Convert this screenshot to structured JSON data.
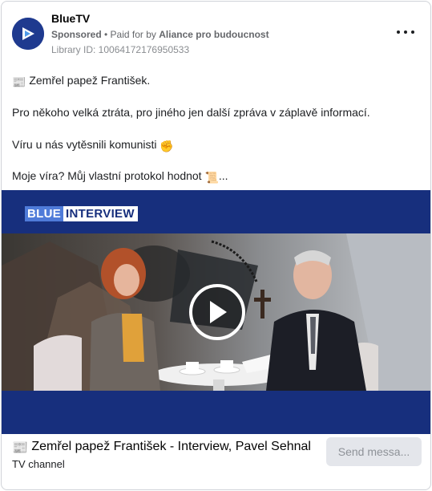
{
  "header": {
    "page_name": "BlueTV",
    "sponsored": "Sponsored",
    "separator": " • ",
    "paid_prefix": "Paid for by ",
    "payer": "Aliance pro budoucnost",
    "library_id": "Library ID: 10064172176950533"
  },
  "post": {
    "line1_emoji": "📰",
    "line1": "Zemřel papež František.",
    "line2": "Pro někoho velká ztráta, pro jiného jen další zpráva v záplavě informací.",
    "line3": "Víru u nás vytěsnili komunisti",
    "line3_emoji": "✊",
    "line4": "Moje víra? Můj vlastní protokol hodnot",
    "line4_emoji": "📜",
    "line4_suffix": "..."
  },
  "video": {
    "logo_part1": "BLUE",
    "logo_part2": "INTERVIEW",
    "play_icon": "play-icon"
  },
  "footer": {
    "title_emoji": "📰",
    "title": "Zemřel papež František - Interview, Pavel Sehnal",
    "subtitle": "TV channel",
    "cta": "Send messa..."
  },
  "colors": {
    "brand_blue": "#172f7d",
    "avatar_bg": "#1f3a8f",
    "cta_bg": "#e4e6eb"
  }
}
